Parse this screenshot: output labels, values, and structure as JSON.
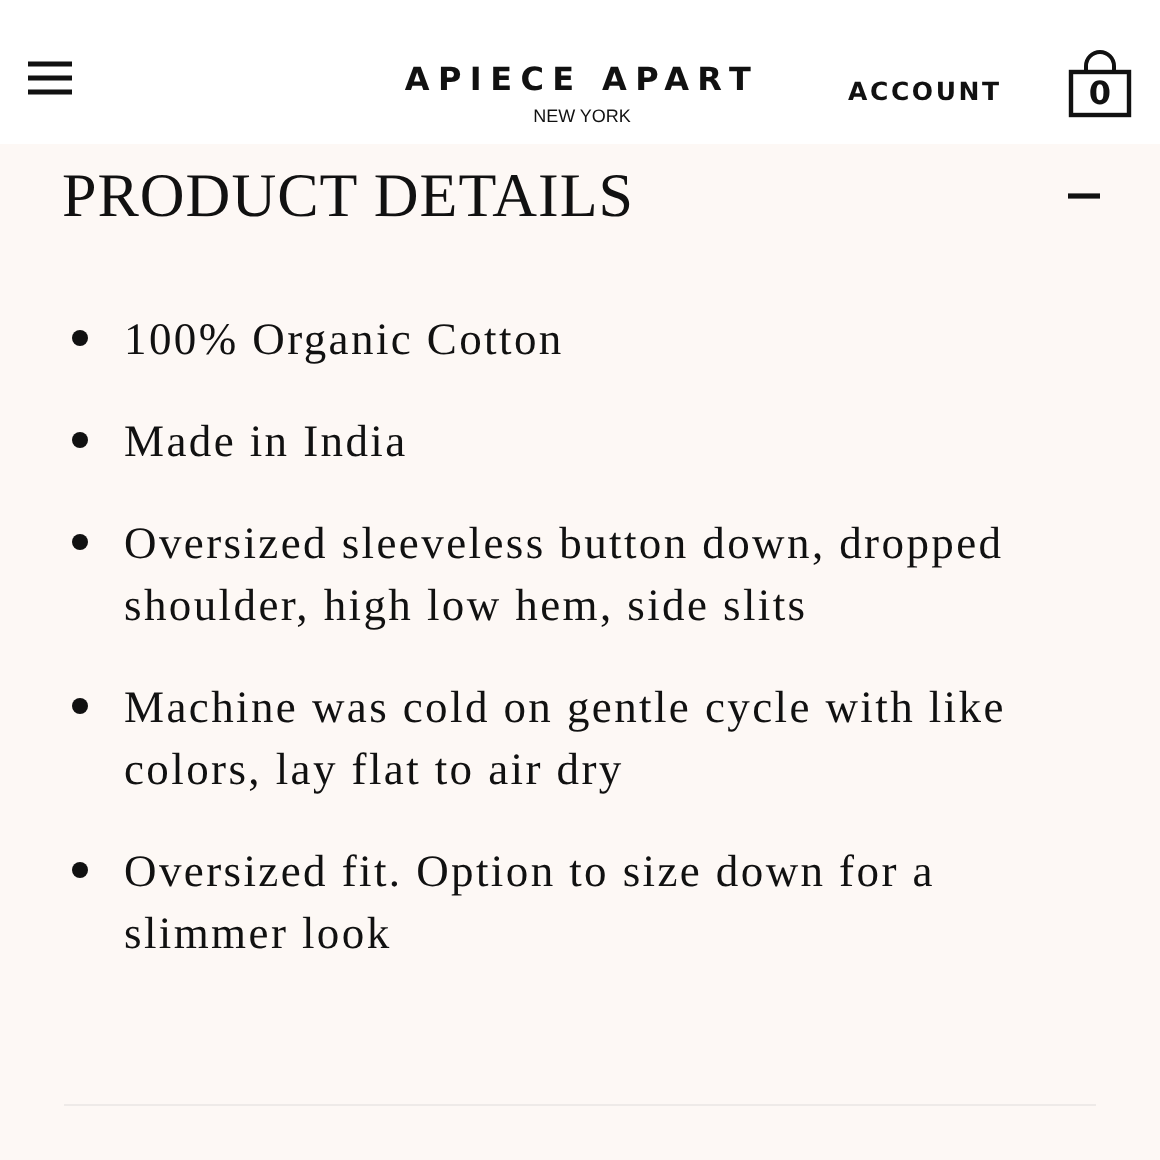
{
  "header": {
    "brand": "APIECE APART",
    "location": "NEW YORK",
    "account": "ACCOUNT",
    "cart_count": "0"
  },
  "section": {
    "title": "PRODUCT DETAILS",
    "expanded": true,
    "items": [
      "100% Organic Cotton",
      "Made in India",
      "Oversized sleeveless button down, dropped shoulder, high low hem, side slits",
      "Machine was cold on gentle cycle with like colors, lay flat to air dry",
      "Oversized fit. Option to size down for a slimmer look"
    ]
  }
}
